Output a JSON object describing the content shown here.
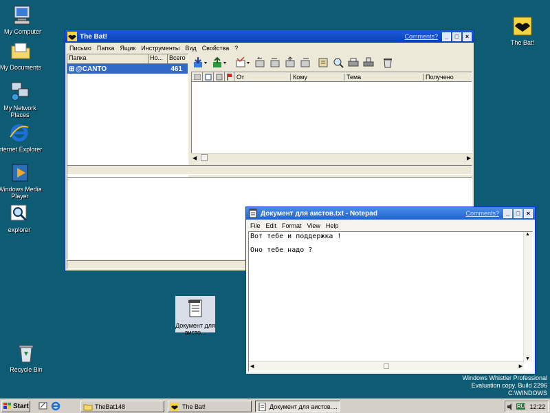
{
  "desktop": {
    "icons": [
      {
        "label": "My Computer"
      },
      {
        "label": "My Documents"
      },
      {
        "label": "My Network Places"
      },
      {
        "label": "Internet Explorer"
      },
      {
        "label": "Windows Media Player"
      },
      {
        "label": "explorer"
      },
      {
        "label": "Recycle Bin"
      },
      {
        "label": "The Bat!"
      },
      {
        "label": "Документ для аисто..."
      }
    ],
    "watermark": {
      "line1": "Windows Whistler Professional",
      "line2": "Evaluation copy. Build 2296",
      "line3": "C:\\WINDOWS"
    }
  },
  "thebat": {
    "title": "The Bat!",
    "comments": "Comments?",
    "menu": [
      "Письмо",
      "Папка",
      "Ящик",
      "Инструменты",
      "Вид",
      "Свойства",
      "?"
    ],
    "folder_headers": {
      "folder": "Папка",
      "new": "Но...",
      "total": "Всего"
    },
    "folders": [
      {
        "expander": "⊞",
        "name": "@CANTO",
        "count": "461"
      }
    ],
    "message_headers": {
      "from": "От",
      "to": "Кому",
      "subject": "Тема",
      "received": "Получено"
    }
  },
  "notepad": {
    "title": "Документ для аистов.txt - Notepad",
    "comments": "Comments?",
    "menu": [
      "File",
      "Edit",
      "Format",
      "View",
      "Help"
    ],
    "lines": [
      "Вот тебе и поддержка !",
      "",
      "Оно тебе надо ?"
    ]
  },
  "taskbar": {
    "start": "Start",
    "items": [
      {
        "label": "TheBat148"
      },
      {
        "label": "The Bat!"
      },
      {
        "label": "Документ для аистов...."
      }
    ],
    "tray": {
      "lang": "RU",
      "clock": "12:22"
    }
  },
  "window_buttons": {
    "minimize": "_",
    "maximize": "□",
    "close": "×"
  }
}
